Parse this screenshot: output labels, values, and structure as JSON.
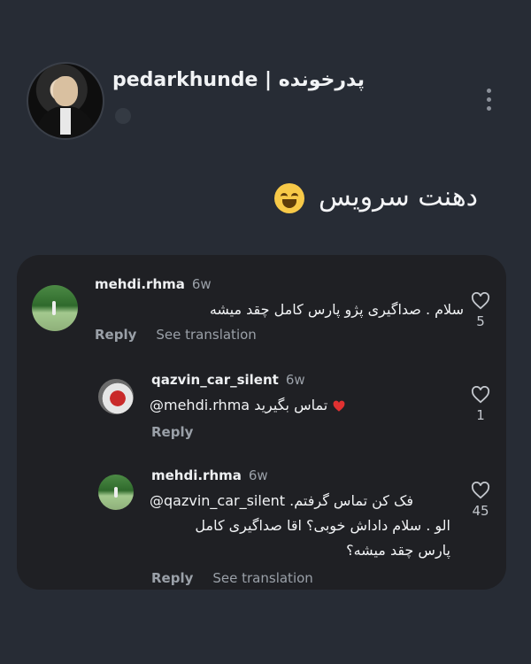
{
  "post": {
    "username": "pedarkhunde | پدرخونده",
    "caption": "دهنت سرویس"
  },
  "comments": [
    {
      "username": "mehdi.rhma",
      "time": "6w",
      "text": "سلام . صداگیری پژو پارس کامل چقد میشه",
      "reply_label": "Reply",
      "translate_label": "See translation",
      "likes": "5"
    },
    {
      "username": "qazvin_car_silent",
      "time": "6w",
      "mention": "@mehdi.rhma",
      "text": "تماس بگیرید",
      "reply_label": "Reply",
      "likes": "1"
    },
    {
      "username": "mehdi.rhma",
      "time": "6w",
      "mention": "@qazvin_car_silent",
      "text_line1": "فک کن تماس گرفتم.",
      "text_line2": "الو . سلام داداش خوبی؟ اقا صداگیری کامل",
      "text_line3": "پارس چقد میشه؟",
      "reply_label": "Reply",
      "translate_label": "See translation",
      "likes": "45"
    }
  ],
  "icons": {
    "more": "kebab-icon",
    "like": "heart-icon",
    "emoji": "laughing-emoji"
  },
  "colors": {
    "background": "#272c35",
    "panel": "#1f2024",
    "heart_red": "#e03131"
  }
}
